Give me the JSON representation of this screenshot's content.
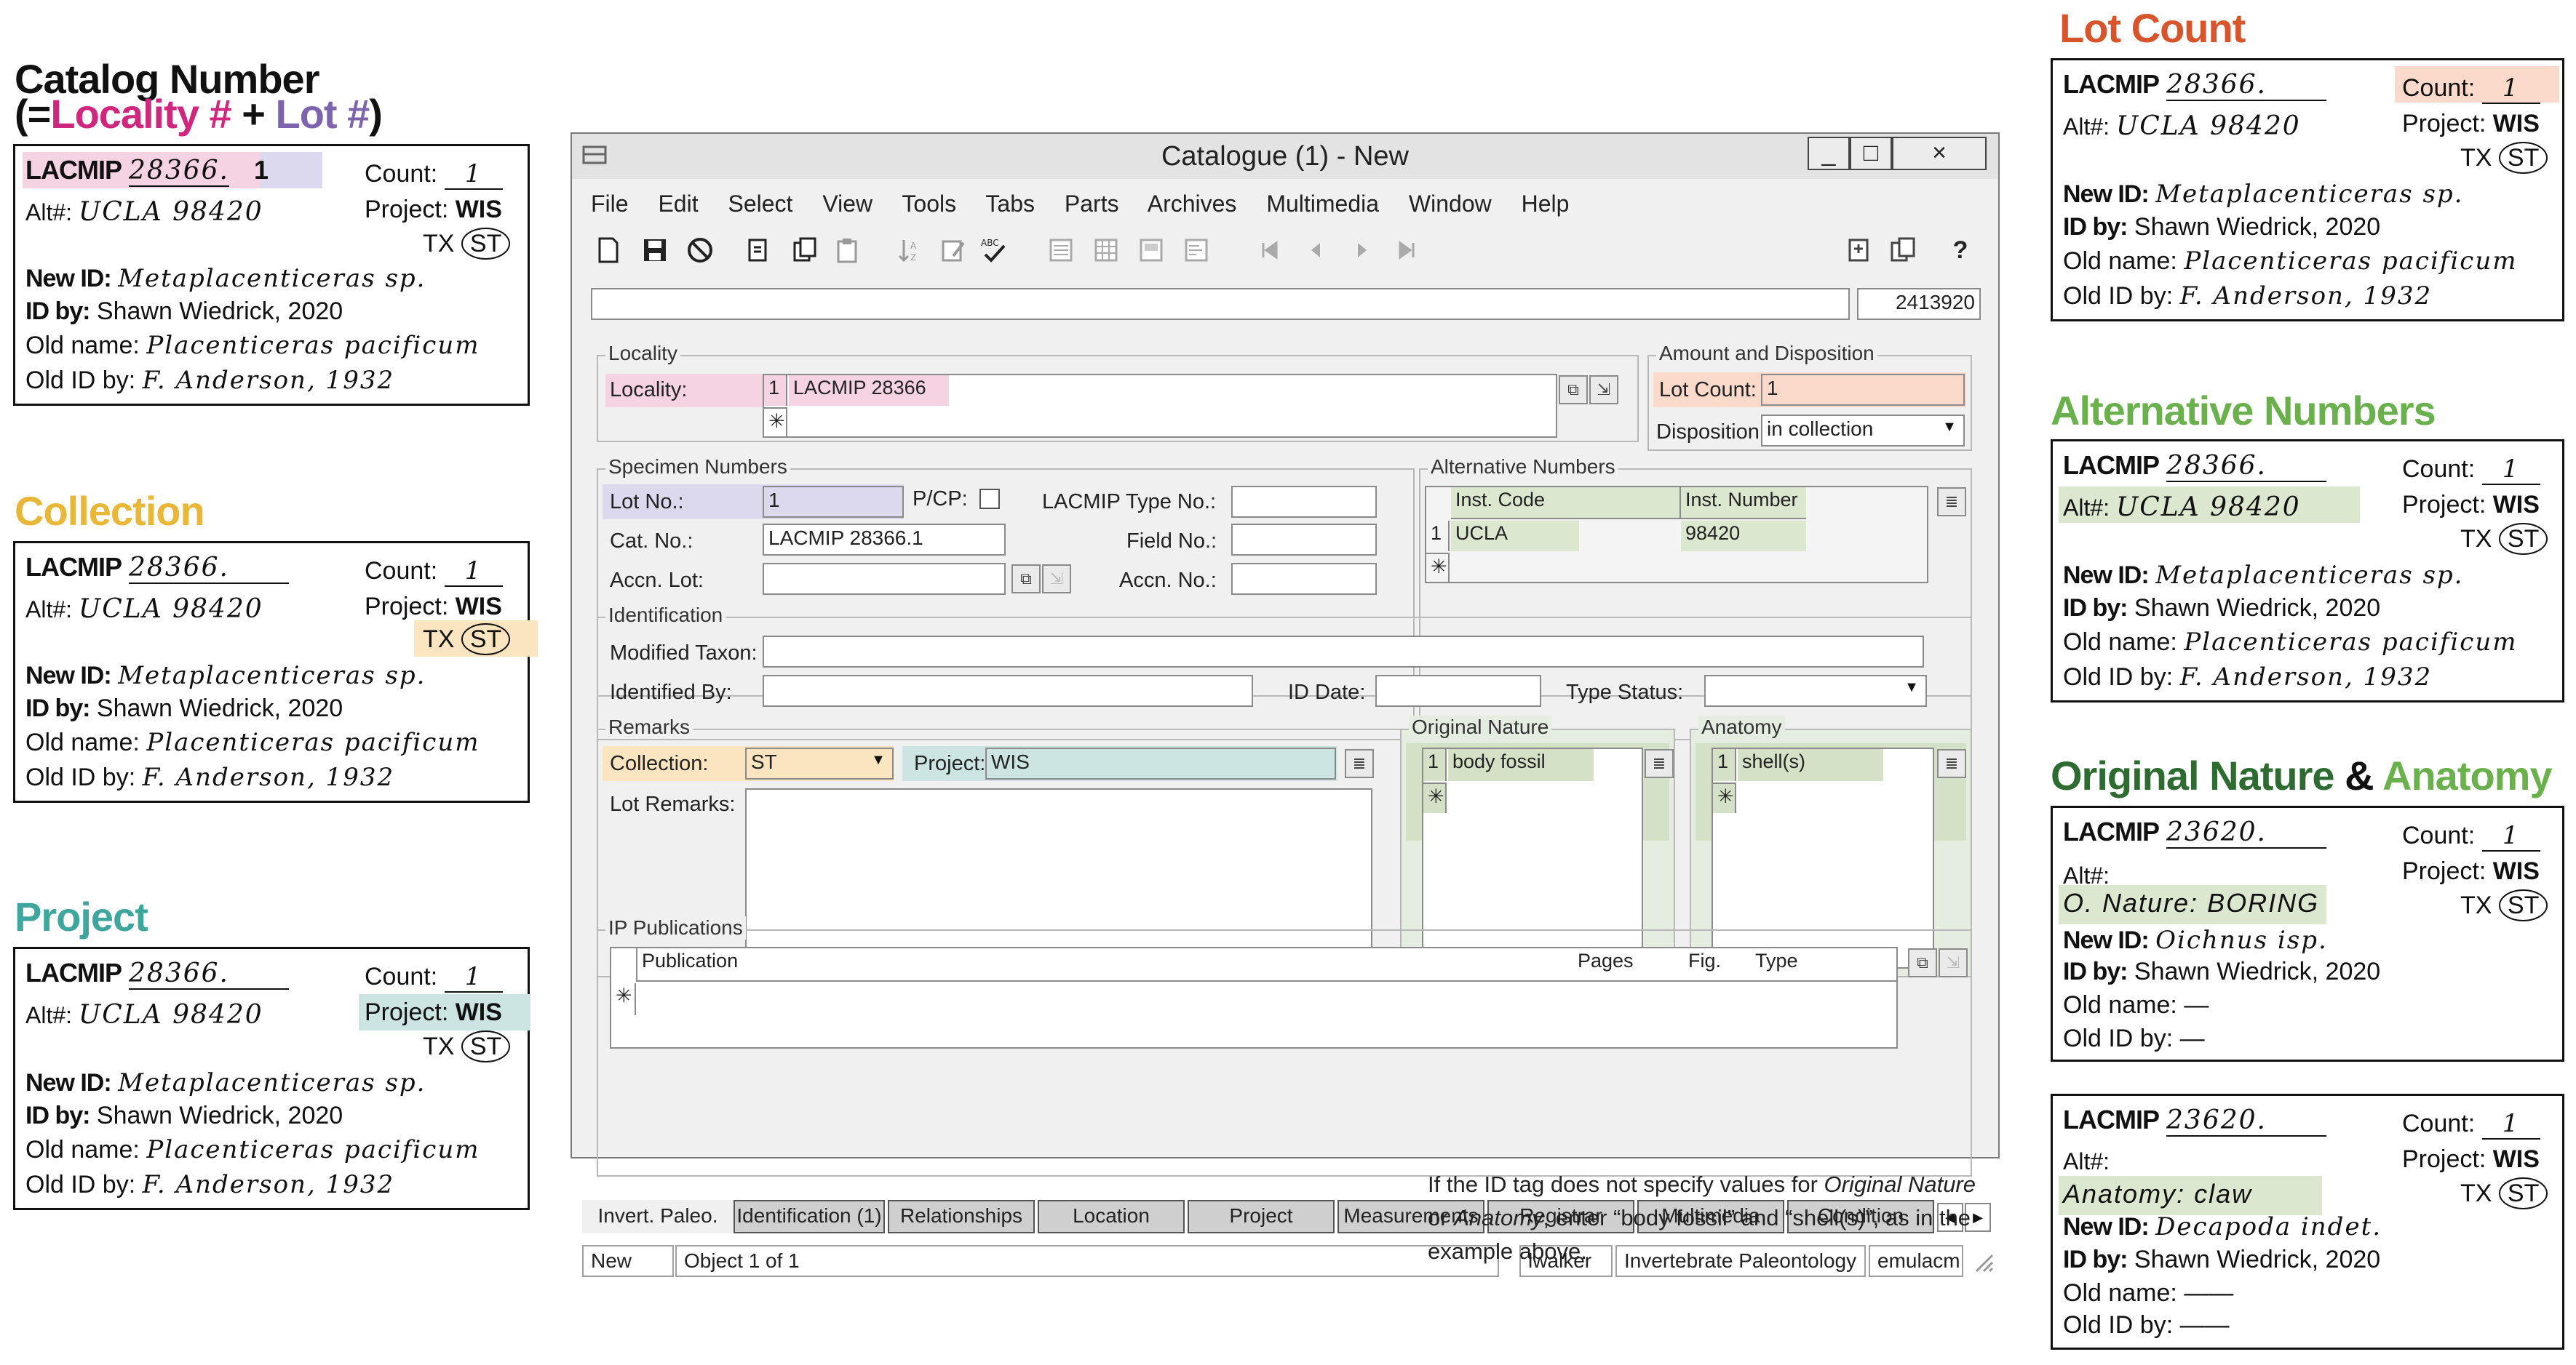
{
  "colors": {
    "locality": "#f5d3e3",
    "lot": "#dcd9ee",
    "count": "#fbd9cb",
    "collection": "#fbe5c0",
    "project": "#cce5e3",
    "altnum": "#dbe8cf",
    "nature": "#d4e1c7",
    "heading_catalog_locality": "#d0277e",
    "heading_catalog_lot": "#7e64ad",
    "heading_collection": "#e8b737",
    "heading_project": "#3fa69e",
    "heading_lotcount": "#d8542b",
    "heading_altnum": "#6ab04c",
    "heading_nature": "#2d6b31"
  },
  "left": {
    "catalog_heading_line1": "Catalog Number",
    "catalog_heading_line2_prefix": "(=",
    "catalog_heading_locality": "Locality #",
    "catalog_heading_plus": " + ",
    "catalog_heading_lot": "Lot #",
    "catalog_heading_suffix": ")",
    "collection_heading": "Collection",
    "project_heading": "Project"
  },
  "right": {
    "lotcount_heading": "Lot Count",
    "altnum_heading": "Alternative Numbers",
    "nature_heading_a": "Original Nature",
    "nature_heading_amp": " & ",
    "nature_heading_b": "Anatomy"
  },
  "card_common": {
    "lacmip": "LACMIP",
    "number": "28366.",
    "count_label": "Count:",
    "count_value": "1",
    "alt_label": "Alt#:",
    "alt_value": "UCLA 98420",
    "project_label": "Project:",
    "project_value": "WIS",
    "tx": "TX",
    "st": "ST",
    "newid_label": "New ID:",
    "newid_value": "Metaplacenticeras sp.",
    "idby_label": "ID by:",
    "idby_value": "Shawn Wiedrick, 2020",
    "oldname_label": "Old name:",
    "oldname_value": "Placenticeras pacificum",
    "oldidby_label": "Old ID by:",
    "oldidby_value": "F. Anderson, 1932"
  },
  "card_lot_value": "1",
  "card_onat": {
    "number": "23620.",
    "alt_value": "",
    "nature_value": "O. Nature: BORING",
    "newid_value": "Oichnus isp.",
    "oldname_value": "—",
    "oldidby_value": "—"
  },
  "card_anat": {
    "number": "23620.",
    "anatomy_value": "Anatomy: claw",
    "newid_value": "Decapoda indet.",
    "oldname_value": "——",
    "oldidby_value": "——"
  },
  "window": {
    "title": "Catalogue (1) - New",
    "menu": [
      "File",
      "Edit",
      "Select",
      "View",
      "Tools",
      "Tabs",
      "Parts",
      "Archives",
      "Multimedia",
      "Window",
      "Help"
    ],
    "record_id": "2413920",
    "btn_min": "_",
    "btn_max": "□",
    "btn_close": "×",
    "help_icon": "?",
    "locality_group": "Locality",
    "locality_label": "Locality:",
    "locality_rownum": "1",
    "locality_value": "LACMIP 28366",
    "new_row": "✳",
    "amount_group": "Amount and Disposition",
    "lot_count_label": "Lot Count:",
    "lot_count_value": "1",
    "disposition_label": "Disposition:",
    "disposition_value": "in collection",
    "specimen_group": "Specimen Numbers",
    "lot_no_label": "Lot No.:",
    "lot_no_value": "1",
    "pcp_label": "P/CP:",
    "type_no_label": "LACMIP Type No.:",
    "cat_no_label": "Cat. No.:",
    "cat_no_value": "LACMIP 28366.1",
    "field_no_label": "Field No.:",
    "accn_lot_label": "Accn. Lot:",
    "accn_no_label": "Accn. No.:",
    "altnum_group": "Alternative Numbers",
    "altnum_col1": "Inst. Code",
    "altnum_col2": "Inst. Number",
    "altnum_rownum": "1",
    "altnum_code": "UCLA",
    "altnum_number": "98420",
    "ident_group": "Identification",
    "modified_taxon_label": "Modified Taxon:",
    "identified_by_label": "Identified By:",
    "id_date_label": "ID Date:",
    "type_status_label": "Type Status:",
    "remarks_group": "Remarks",
    "collection_label": "Collection:",
    "collection_value": "ST",
    "project_label": "Project:",
    "project_value": "WIS",
    "lot_remarks_label": "Lot Remarks:",
    "nature_group": "Original Nature",
    "nature_rownum": "1",
    "nature_value": "body fossil",
    "anatomy_group": "Anatomy",
    "anatomy_rownum": "1",
    "anatomy_value": "shell(s)",
    "pubs_group": "IP Publications",
    "pub_col": "Publication",
    "pages_col": "Pages",
    "fig_col": "Fig.",
    "type_col": "Type",
    "tabs": [
      "Invert. Paleo.",
      "Identification (1)",
      "Relationships",
      "Location",
      "Project",
      "Measurements",
      "Registrar",
      "Multimedia",
      "Condition"
    ],
    "status_new": "New",
    "status_object": "Object 1 of 1",
    "status_user": "lwalker",
    "status_dept": "Invertebrate Paleontology",
    "status_db": "emulacm"
  },
  "note": {
    "t1": "If the ID tag does not specify values for ",
    "t2": "Original Nature",
    "t3": "or ",
    "t4": "Anatomy",
    "t5": ", enter “body fossil” and “shell(s)”, as in the",
    "t6": "example above."
  }
}
